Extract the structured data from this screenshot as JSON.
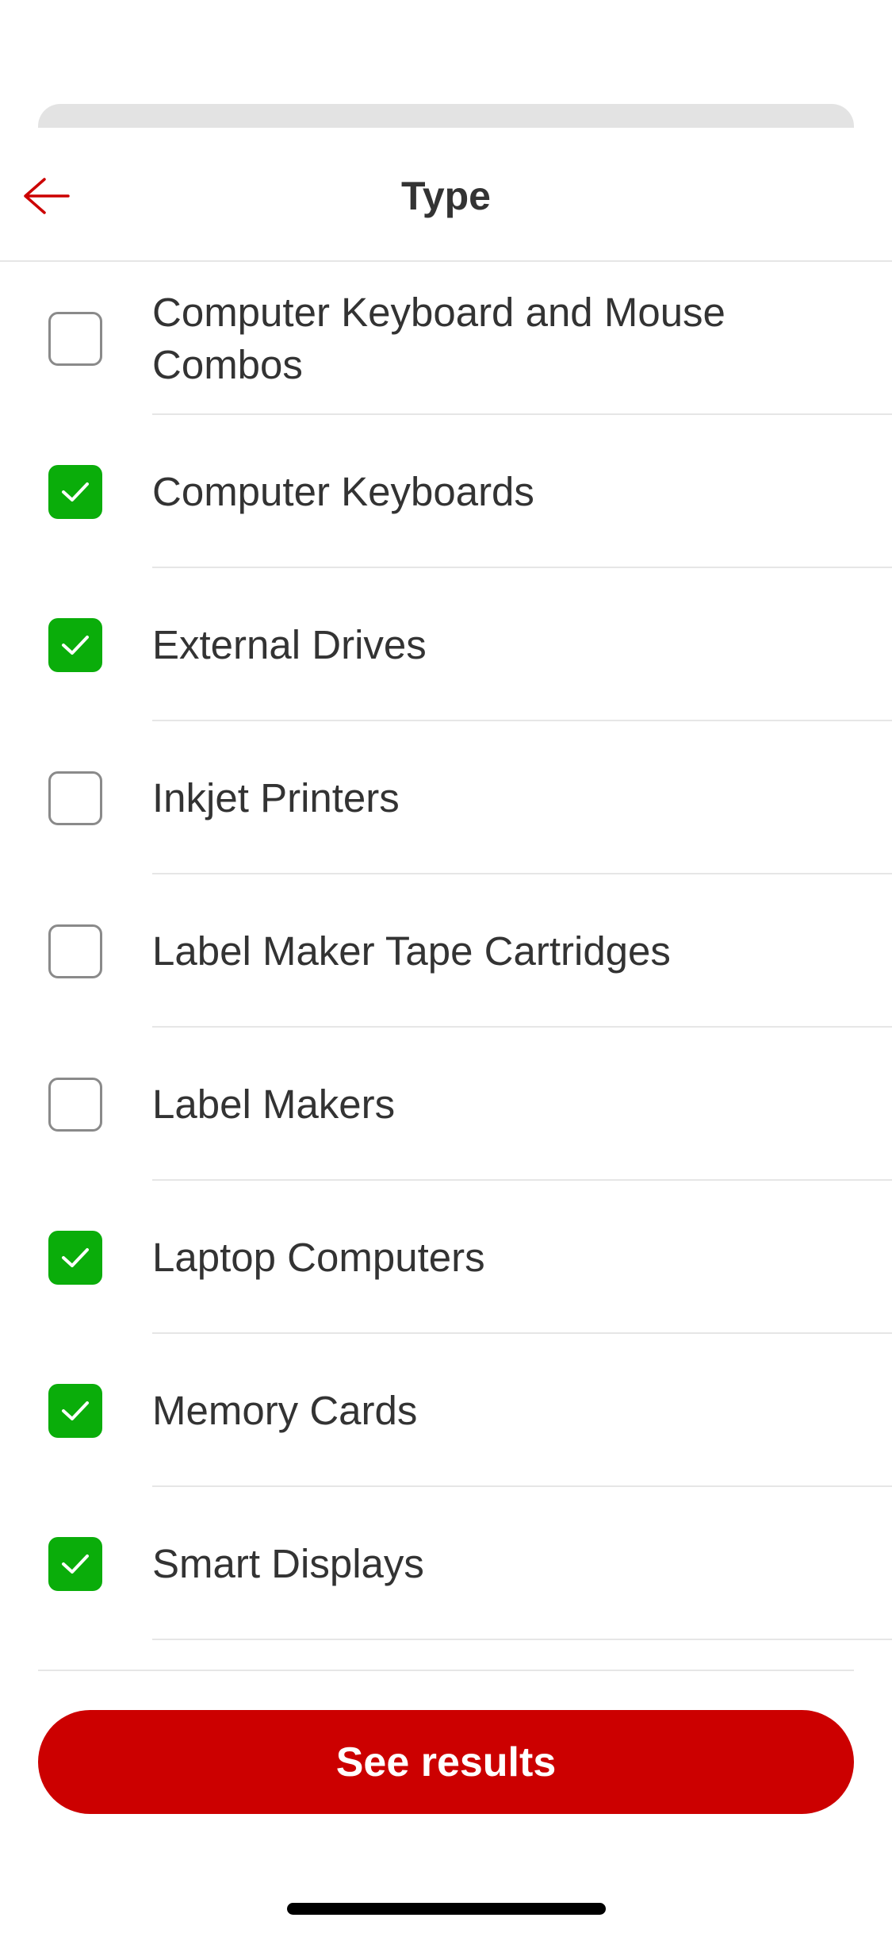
{
  "header": {
    "title": "Type"
  },
  "options": [
    {
      "label": "Computer Keyboard and Mouse Combos",
      "checked": false
    },
    {
      "label": "Computer Keyboards",
      "checked": true
    },
    {
      "label": "External Drives",
      "checked": true
    },
    {
      "label": "Inkjet Printers",
      "checked": false
    },
    {
      "label": "Label Maker Tape Cartridges",
      "checked": false
    },
    {
      "label": "Label Makers",
      "checked": false
    },
    {
      "label": "Laptop Computers",
      "checked": true
    },
    {
      "label": "Memory Cards",
      "checked": true
    },
    {
      "label": "Smart Displays",
      "checked": true
    }
  ],
  "footer": {
    "button_label": "See results"
  },
  "colors": {
    "accent": "#cc0000",
    "checked": "#0aad0a",
    "text": "#333333",
    "divider": "#e6e6e6"
  },
  "icons": {
    "back": "arrow-left-icon",
    "check": "checkmark-icon"
  }
}
